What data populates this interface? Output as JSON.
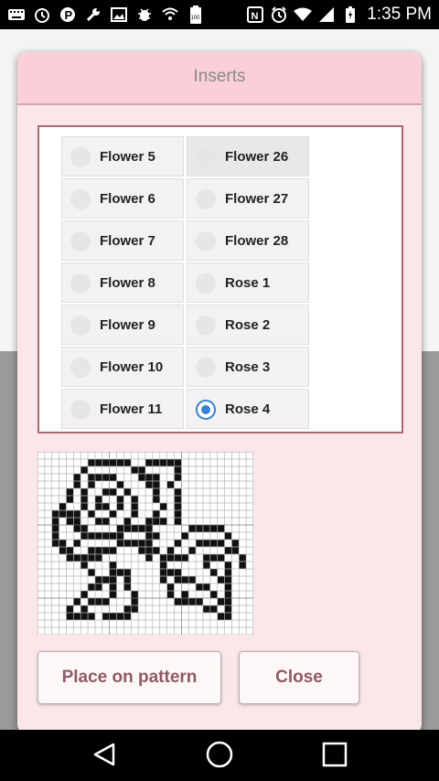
{
  "status_bar": {
    "time": "1:35 PM",
    "battery_text": "100"
  },
  "dialog": {
    "title": "Inserts",
    "list": {
      "column1": [
        {
          "label": "Flower 5",
          "selected": false
        },
        {
          "label": "Flower 6",
          "selected": false
        },
        {
          "label": "Flower 7",
          "selected": false
        },
        {
          "label": "Flower 8",
          "selected": false
        },
        {
          "label": "Flower 9",
          "selected": false
        },
        {
          "label": "Flower 10",
          "selected": false
        },
        {
          "label": "Flower 11",
          "selected": false
        }
      ],
      "column2": [
        {
          "label": "Flower 26",
          "selected": false
        },
        {
          "label": "Flower 27",
          "selected": false
        },
        {
          "label": "Flower 28",
          "selected": false
        },
        {
          "label": "Rose 1",
          "selected": false
        },
        {
          "label": "Rose 2",
          "selected": false
        },
        {
          "label": "Rose 3",
          "selected": false
        },
        {
          "label": "Rose 4",
          "selected": true
        }
      ]
    },
    "buttons": {
      "place_label": "Place on pattern",
      "close_label": "Close"
    }
  },
  "colors": {
    "dialog_bg": "#fbe6ea",
    "header_bg": "#fbcfd8",
    "list_border": "#a9696f",
    "button_text": "#8d5b61",
    "radio_selected": "#3a7fd0"
  },
  "preview_pattern": [
    "..............................",
    ".......######..#####..........",
    "......#......##....#..........",
    ".....#.####...###..#..........",
    ".....#.#...#...##.#...........",
    "....#.#..##.#...#..#..........",
    "....#.#.#..#.#..#..#..........",
    "...#..#.##.#.#...#.#..........",
    "..####.#..#..#..#..#..........",
    "..#.##..##..#..###.#..........",
    "..#..##....#####.....#####....",
    "..#...######...##...#.....#...",
    "..##.#.....#####...#..####.#..",
    "...##..####...###.#..#....##..",
    "....#####......#.####..###..#.",
    "......#...#......#.....#..#.#.",
    ".......#..###....###....#.#...",
    "........###.#....#.###...##...",
    ".......##.#.#.....#...##..#...",
    "......#...#..#....#.#...#.#...",
    ".....#.###...#.....####..##...",
    "....#.#.....##.........##.#...",
    "....####.####............##...",
    "..............................",
    ".............................."
  ]
}
